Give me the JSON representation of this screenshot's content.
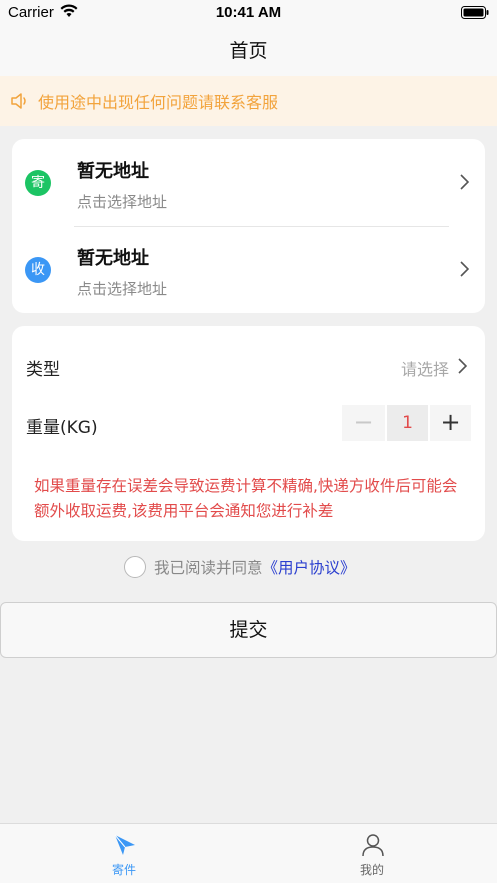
{
  "status_bar": {
    "carrier": "Carrier",
    "time": "10:41 AM"
  },
  "nav": {
    "title": "首页"
  },
  "notice": {
    "text": "使用途中出现任何问题请联系客服",
    "icon": "speaker-icon"
  },
  "sender": {
    "badge": "寄",
    "title": "暂无地址",
    "subtitle": "点击选择地址"
  },
  "receiver": {
    "badge": "收",
    "title": "暂无地址",
    "subtitle": "点击选择地址"
  },
  "form": {
    "type_label": "类型",
    "type_value": "请选择",
    "weight_label": "重量(KG)",
    "weight_value": "1",
    "minus": "−",
    "plus": "+",
    "warning": "如果重量存在误差会导致运费计算不精确,快递方收件后可能会额外收取运费,该费用平台会通知您进行补差"
  },
  "agreement": {
    "text": "我已阅读并同意",
    "link": "《用户协议》",
    "checked": false
  },
  "submit_label": "提交",
  "tabs": [
    {
      "label": "寄件",
      "icon": "paper-plane-icon",
      "active": true
    },
    {
      "label": "我的",
      "icon": "user-icon",
      "active": false
    }
  ],
  "colors": {
    "accent_blue": "#3b97f5",
    "send_green": "#1cc464",
    "warning_red": "#e24b4b",
    "notice_orange": "#f2a33c",
    "link_blue": "#2b3fcf"
  }
}
